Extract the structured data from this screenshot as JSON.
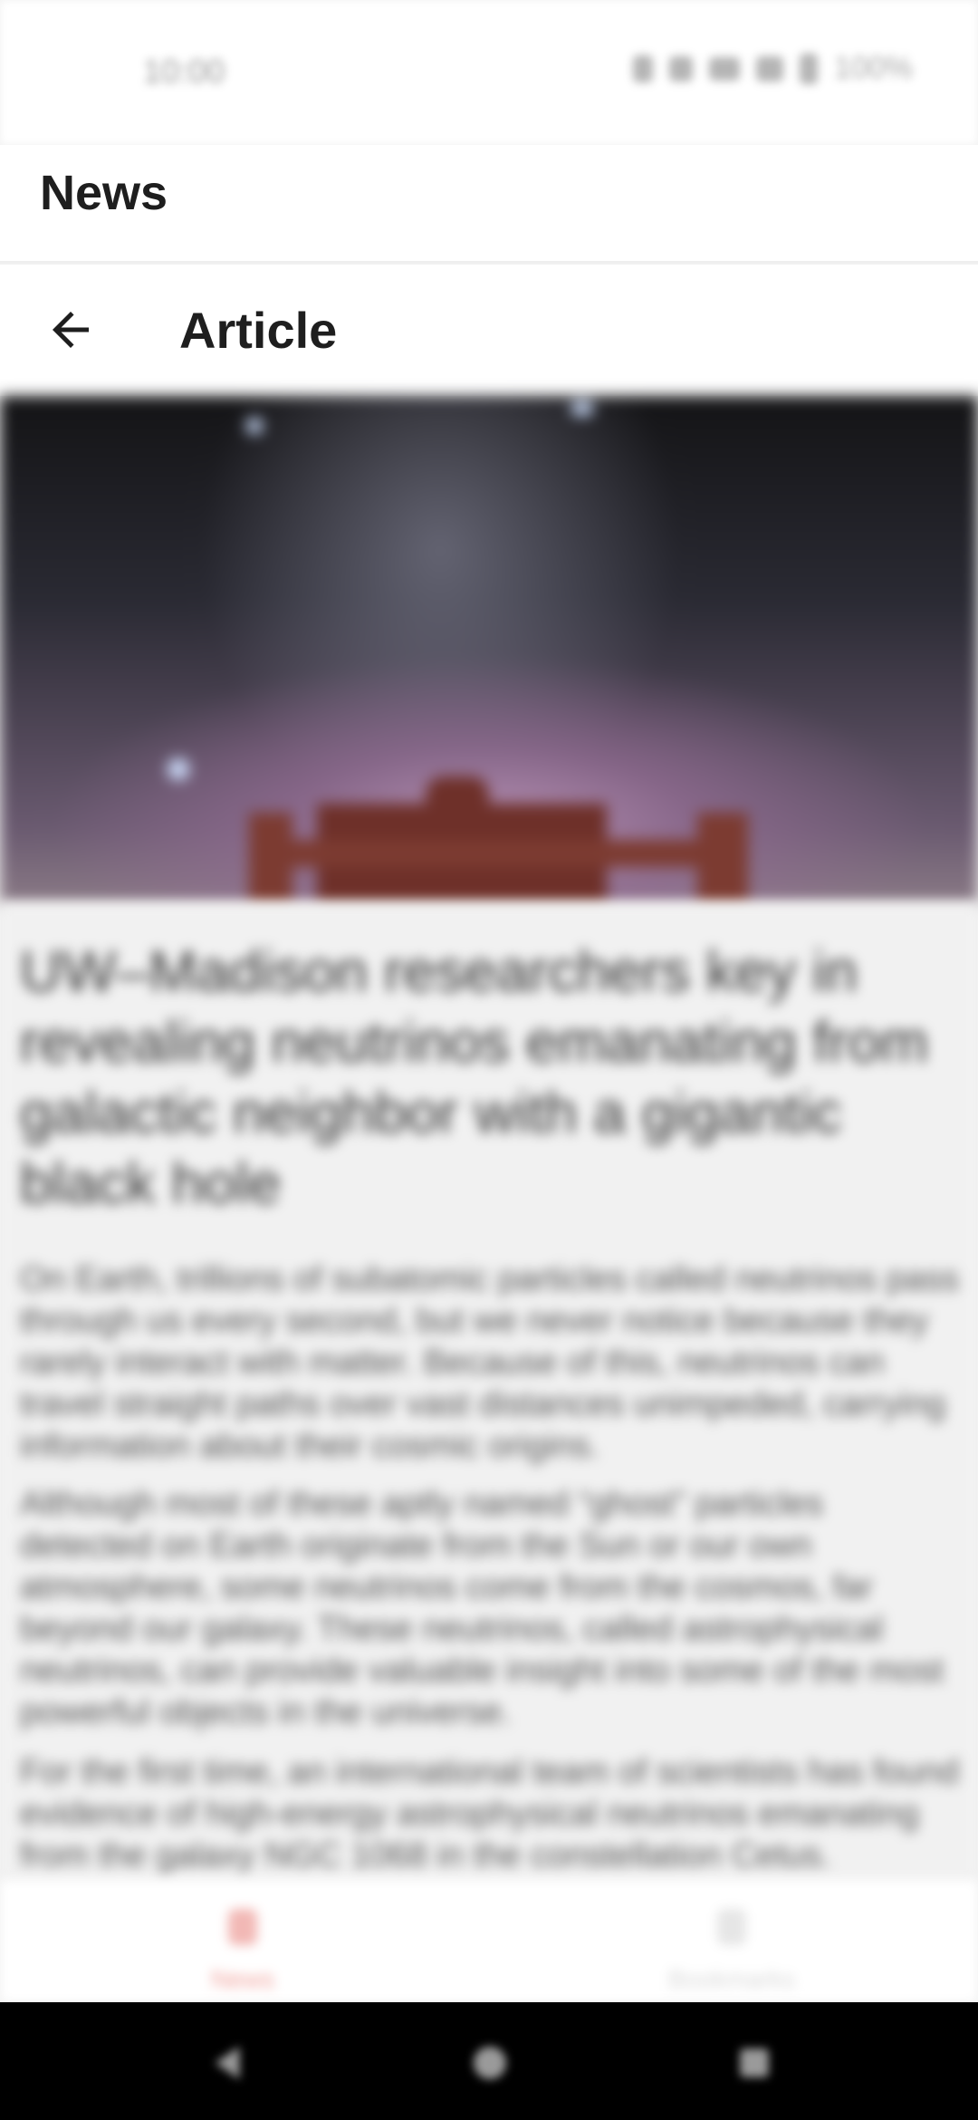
{
  "status_bar": {
    "time": "10:00",
    "battery": "100%"
  },
  "app_header": {
    "title": "News"
  },
  "article_bar": {
    "title": "Article",
    "back_icon": "arrow-left-icon"
  },
  "article": {
    "headline": "UW–Madison researchers key in revealing neutrinos emanating from galactic neighbor with a gigantic black hole",
    "paragraphs": [
      "On Earth, trillions of subatomic particles called neutrinos pass through us every second, but we never notice because they rarely interact with matter. Because of this, neutrinos can travel straight paths over vast distances unimpeded, carrying information about their cosmic origins.",
      "Although most of these aptly named “ghost” particles detected on Earth originate from the Sun or our own atmosphere, some neutrinos come from the cosmos, far beyond our galaxy. These neutrinos, called astrophysical neutrinos, can provide valuable insight into some of the most powerful objects in the universe.",
      "For the first time, an international team of scientists has found evidence of high-energy astrophysical neutrinos emanating from the galaxy NGC 1068 in the constellation Cetus."
    ]
  },
  "bottom_nav": {
    "items": [
      {
        "label": "News",
        "icon": "news-icon",
        "active": true
      },
      {
        "label": "Bookmarks",
        "icon": "bookmark-icon",
        "active": false
      }
    ],
    "active_color": "#e53935",
    "inactive_color": "#9e9e9e"
  },
  "colors": {
    "app_background": "#f1f1f1",
    "header_background": "#ffffff",
    "system_nav_background": "#000000"
  }
}
